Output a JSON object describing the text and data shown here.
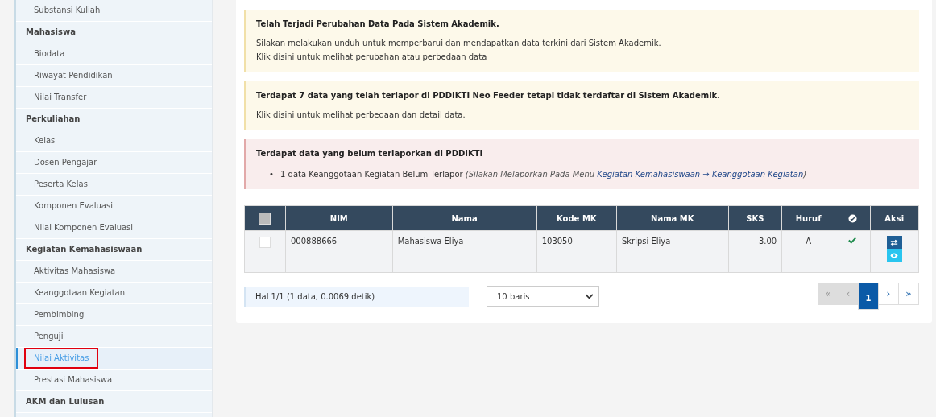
{
  "sidebar": {
    "groups": [
      {
        "items": [
          {
            "label": "Substansi Kuliah",
            "selected": false
          }
        ]
      },
      {
        "label": "Mahasiswa",
        "items": [
          {
            "label": "Biodata",
            "selected": false
          },
          {
            "label": "Riwayat Pendidikan",
            "selected": false
          },
          {
            "label": "Nilai Transfer",
            "selected": false
          }
        ]
      },
      {
        "label": "Perkuliahan",
        "items": [
          {
            "label": "Kelas",
            "selected": false
          },
          {
            "label": "Dosen Pengajar",
            "selected": false
          },
          {
            "label": "Peserta Kelas",
            "selected": false
          },
          {
            "label": "Komponen Evaluasi",
            "selected": false
          },
          {
            "label": "Nilai Komponen Evaluasi",
            "selected": false
          }
        ]
      },
      {
        "label": "Kegiatan Kemahasiswaan",
        "items": [
          {
            "label": "Aktivitas Mahasiswa",
            "selected": false
          },
          {
            "label": "Keanggotaan Kegiatan",
            "selected": false
          },
          {
            "label": "Pembimbing",
            "selected": false
          },
          {
            "label": "Penguji",
            "selected": false
          },
          {
            "label": "Nilai Aktivitas",
            "selected": true
          },
          {
            "label": "Prestasi Mahasiswa",
            "selected": false
          }
        ]
      },
      {
        "label": "AKM dan Lulusan"
      }
    ]
  },
  "alerts": [
    {
      "kind": "warning",
      "title": "Telah Terjadi Perubahan Data Pada Sistem Akademik.",
      "lines": [
        "Silakan melakukan unduh untuk memperbarui dan mendapatkan data terkini dari Sistem Akademik.",
        "Klik disini untuk melihat perubahan atau perbedaan data"
      ]
    },
    {
      "kind": "warning",
      "title": "Terdapat 7 data yang telah terlapor di PDDIKTI Neo Feeder tetapi tidak terdaftar di Sistem Akademik.",
      "lines": [
        "Klik disini untuk melihat perbedaan dan detail data."
      ]
    },
    {
      "kind": "danger",
      "title": "Terdapat data yang belum terlaporkan di PDDIKTI",
      "bullets": [
        {
          "marker": "•",
          "text": "1 data Keanggotaan Kegiatan Belum Terlapor",
          "note": "(Silakan Melaporkan Pada Menu",
          "link": "Kegiatan Kemahasiswaan → Keanggotaan Kegiatan",
          "note_end": ")"
        }
      ]
    }
  ],
  "table": {
    "columns": [
      {
        "kind": "checkbox",
        "checked": false
      },
      {
        "kind": "text",
        "label": "NIM"
      },
      {
        "kind": "text",
        "label": "Nama"
      },
      {
        "kind": "text",
        "label": "Kode MK"
      },
      {
        "kind": "text",
        "label": "Nama MK"
      },
      {
        "kind": "text",
        "label": "SKS"
      },
      {
        "kind": "text",
        "label": "Huruf"
      },
      {
        "kind": "icon"
      },
      {
        "kind": "text",
        "label": "Aksi"
      }
    ],
    "rows": [
      {
        "checked": false,
        "nim": "000888666",
        "nama": "Mahasiswa Eliya",
        "kode_mk": "103050",
        "nama_mk": "Skripsi Eliya",
        "sks": "3.00",
        "huruf": "A",
        "verified": true
      }
    ]
  },
  "footer": {
    "info": "Hal 1/1 (1 data, 0.0069 detik)",
    "page_size": "10 baris",
    "pagination": [
      {
        "label": "«",
        "disabled": true,
        "selected": false
      },
      {
        "label": "‹",
        "disabled": true,
        "selected": false
      },
      {
        "label": "1",
        "disabled": false,
        "selected": true
      },
      {
        "label": "›",
        "disabled": false,
        "selected": false
      },
      {
        "label": "»",
        "disabled": false,
        "selected": false
      }
    ]
  }
}
